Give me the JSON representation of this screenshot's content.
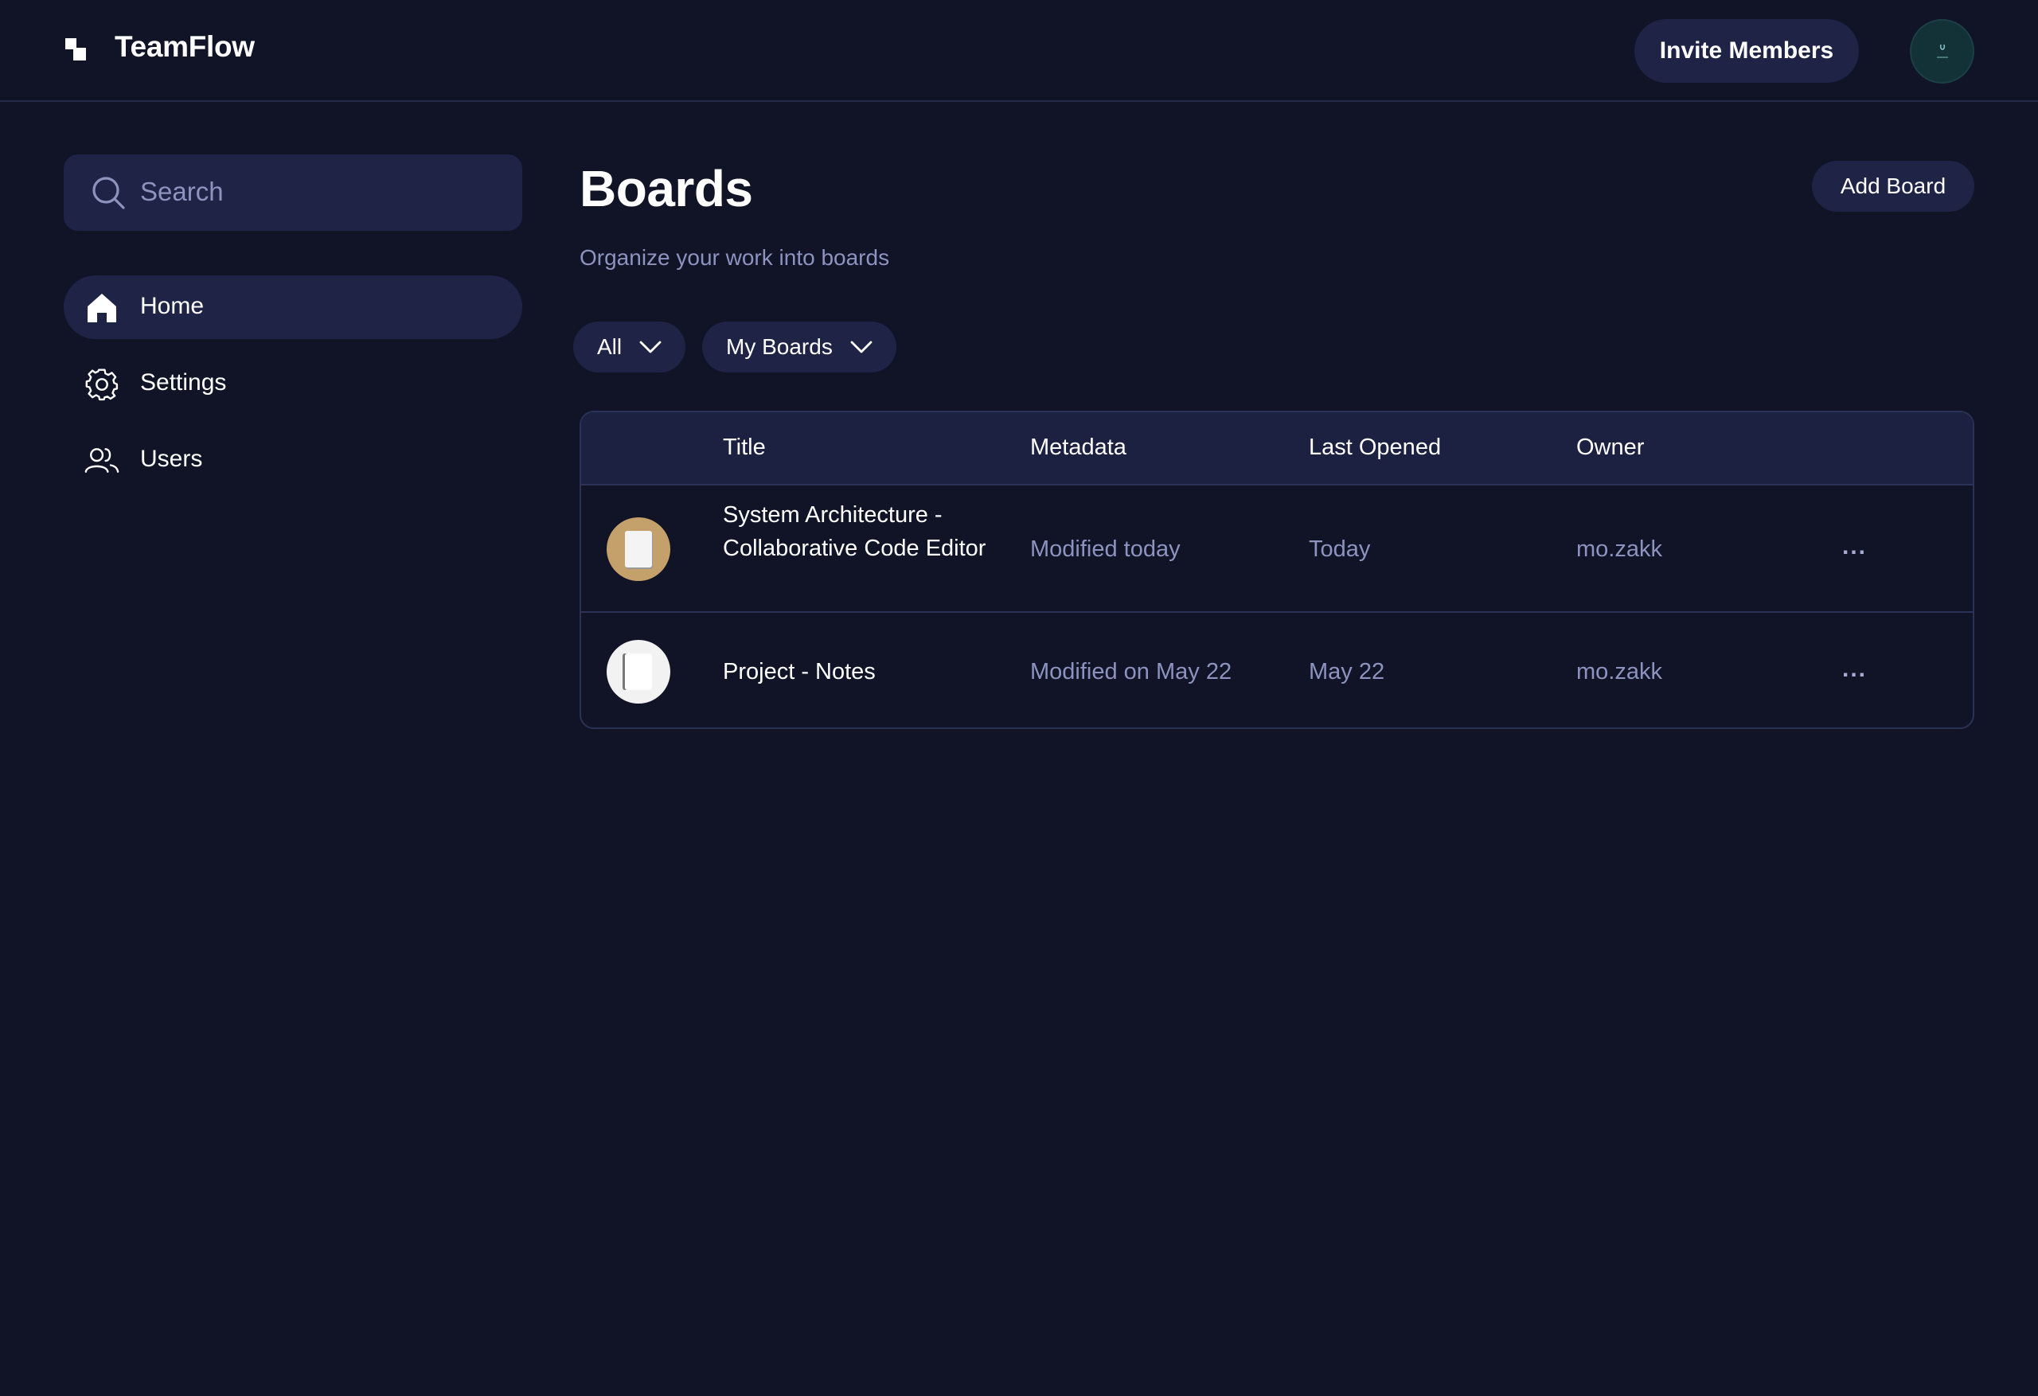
{
  "header": {
    "app_name": "TeamFlow",
    "invite_label": "Invite Members"
  },
  "sidebar": {
    "search_placeholder": "Search",
    "items": [
      {
        "label": "Home",
        "icon": "home-icon",
        "active": true
      },
      {
        "label": "Settings",
        "icon": "gear-icon",
        "active": false
      },
      {
        "label": "Users",
        "icon": "users-icon",
        "active": false
      }
    ]
  },
  "main": {
    "title": "Boards",
    "subtitle": "Organize your work into boards",
    "add_label": "Add Board",
    "filters": [
      {
        "label": "All"
      },
      {
        "label": "My Boards"
      }
    ],
    "table": {
      "columns": [
        "Title",
        "Metadata",
        "Last Opened",
        "Owner"
      ],
      "rows": [
        {
          "title": "System Architecture - Collaborative Code Editor",
          "metadata": "Modified today",
          "last_opened": "Today",
          "owner": "mo.zakk",
          "more": "...",
          "thumb_color": "#c4a06a"
        },
        {
          "title": "Project - Notes",
          "metadata": "Modified on May 22",
          "last_opened": "May 22",
          "owner": "mo.zakk",
          "more": "...",
          "thumb_color": "#f2f2f2"
        }
      ]
    }
  },
  "colors": {
    "background": "#111426",
    "surface": "#1f2446",
    "muted_text": "#8d93bf",
    "border": "#2b3258"
  }
}
